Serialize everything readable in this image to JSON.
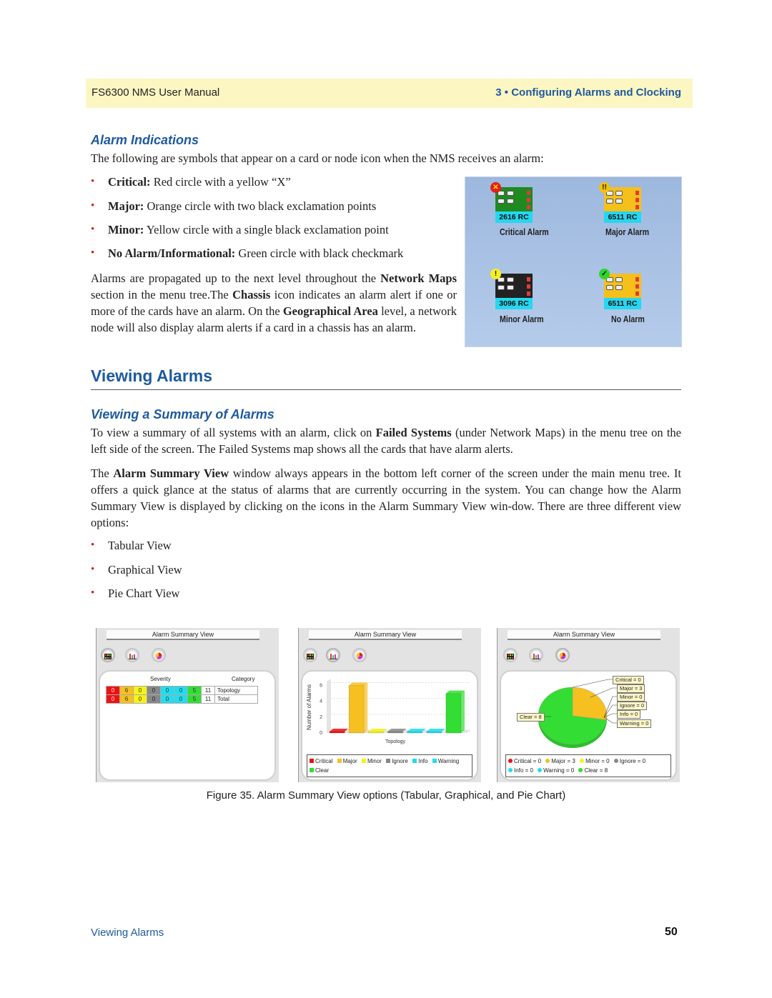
{
  "header": {
    "manual_title": "FS6300 NMS User Manual",
    "chapter": "3 • Configuring Alarms and Clocking"
  },
  "alarm_indications": {
    "heading": "Alarm Indications",
    "intro": "The following are symbols that appear on a card or node icon when the NMS receives an alarm:",
    "bullets": [
      {
        "term": "Critical:",
        "text": " Red circle with a yellow “X”"
      },
      {
        "term": "Major:",
        "text": " Orange circle with two black exclamation points"
      },
      {
        "term": "Minor:",
        "text": " Yellow circle with a single black exclamation point"
      },
      {
        "term": "No Alarm/Informational:",
        "text": " Green circle with black checkmark"
      }
    ],
    "para": {
      "t1": "Alarms are propagated up to the next level throughout the ",
      "b1": "Network Maps",
      "t2": " section in the menu tree.The ",
      "b2": "Chassis",
      "t3": " icon indicates an alarm alert if one or more of the cards have an alarm. On the ",
      "b3": "Geographical Area",
      "t4": " level, a network node will also display alarm alerts if a card in a chassis has an alarm."
    },
    "figure": {
      "cards": [
        {
          "model": "2616 RC",
          "caption": "Critical Alarm",
          "badge": "critical-badge",
          "badge_glyph": "✕",
          "board_color": "#1f8a1f"
        },
        {
          "model": "6511 RC",
          "caption": "Major Alarm",
          "badge": "major-badge",
          "badge_glyph": "!!",
          "board_color": "#f5c019"
        },
        {
          "model": "3096 RC",
          "caption": "Minor Alarm",
          "badge": "minor-badge",
          "badge_glyph": "!",
          "board_color": "#222222"
        },
        {
          "model": "6511 RC",
          "caption": "No Alarm",
          "badge": "no-alarm-badge",
          "badge_glyph": "✓",
          "board_color": "#f5c019"
        }
      ]
    }
  },
  "viewing_alarms": {
    "heading": "Viewing Alarms",
    "subheading": "Viewing a Summary of Alarms",
    "para1": {
      "t1": "To view a summary of all systems with an alarm, click on ",
      "b1": "Failed Systems",
      "t2": " (under Network Maps) in the menu tree on the left side of the screen. The Failed Systems map shows all the cards that have alarm alerts."
    },
    "para2": {
      "t1": "The ",
      "b1": "Alarm Summary View",
      "t2": " window always appears in the bottom left corner of the screen under the main menu tree. It offers a quick glance at the status of alarms that are currently occurring in the system. You can change how the Alarm Summary View is displayed by clicking on the icons in the Alarm Summary View win-dow. There are three different view options:"
    },
    "options": [
      "Tabular View",
      "Graphical View",
      "Pie Chart View"
    ]
  },
  "summary_panels": {
    "title": "Alarm Summary View",
    "view_buttons": [
      "tabular-view",
      "graphical-view",
      "pie-chart-view"
    ],
    "severity_colors": {
      "Critical": "#ee1111",
      "Major": "#f5c020",
      "Minor": "#f6f21a",
      "Ignore": "#888888",
      "Info": "#22ddee",
      "Warning": "#22ddee",
      "Clear": "#33dd33"
    },
    "tabular": {
      "severity_header": "Severity",
      "category_header": "Category",
      "rows": [
        {
          "values": [
            "0",
            "6",
            "0",
            "0",
            "0",
            "0",
            "5"
          ],
          "total": "11",
          "category": "Topology"
        },
        {
          "values": [
            "0",
            "6",
            "0",
            "0",
            "0",
            "0",
            "5"
          ],
          "total": "11",
          "category": "Total"
        }
      ]
    },
    "pie_legend": [
      "Critical = 0",
      "Major = 3",
      "Minor = 0",
      "Ignore = 0",
      "Info = 0",
      "Warning = 0",
      "Clear = 8"
    ],
    "pie_callouts": [
      "Critical = 0",
      "Major = 3",
      "Minor = 0",
      "Ignore = 0",
      "Info = 0",
      "Warning = 0"
    ],
    "pie_clear_callout": "Clear = 8"
  },
  "chart_data": [
    {
      "type": "bar",
      "title": "",
      "xlabel": "Topology",
      "ylabel": "Number of Alarms",
      "categories": [
        "Topology"
      ],
      "series": [
        {
          "name": "Critical",
          "values": [
            0
          ]
        },
        {
          "name": "Major",
          "values": [
            6
          ]
        },
        {
          "name": "Minor",
          "values": [
            0
          ]
        },
        {
          "name": "Ignore",
          "values": [
            0
          ]
        },
        {
          "name": "Info",
          "values": [
            0
          ]
        },
        {
          "name": "Warning",
          "values": [
            0
          ]
        },
        {
          "name": "Clear",
          "values": [
            5
          ]
        }
      ],
      "yticks": [
        "0",
        "2",
        "4",
        "6"
      ],
      "ylim": [
        0,
        6.5
      ],
      "grid": true,
      "legend": "bottom"
    },
    {
      "type": "pie",
      "title": "",
      "labels": [
        "Critical",
        "Major",
        "Minor",
        "Ignore",
        "Info",
        "Warning",
        "Clear"
      ],
      "values": [
        0,
        3,
        0,
        0,
        0,
        0,
        8
      ],
      "legend": "bottom"
    }
  ],
  "figure_caption": "Figure 35. Alarm Summary View options (Tabular, Graphical, and Pie Chart)",
  "footer": {
    "section": "Viewing Alarms",
    "page_number": "50"
  }
}
